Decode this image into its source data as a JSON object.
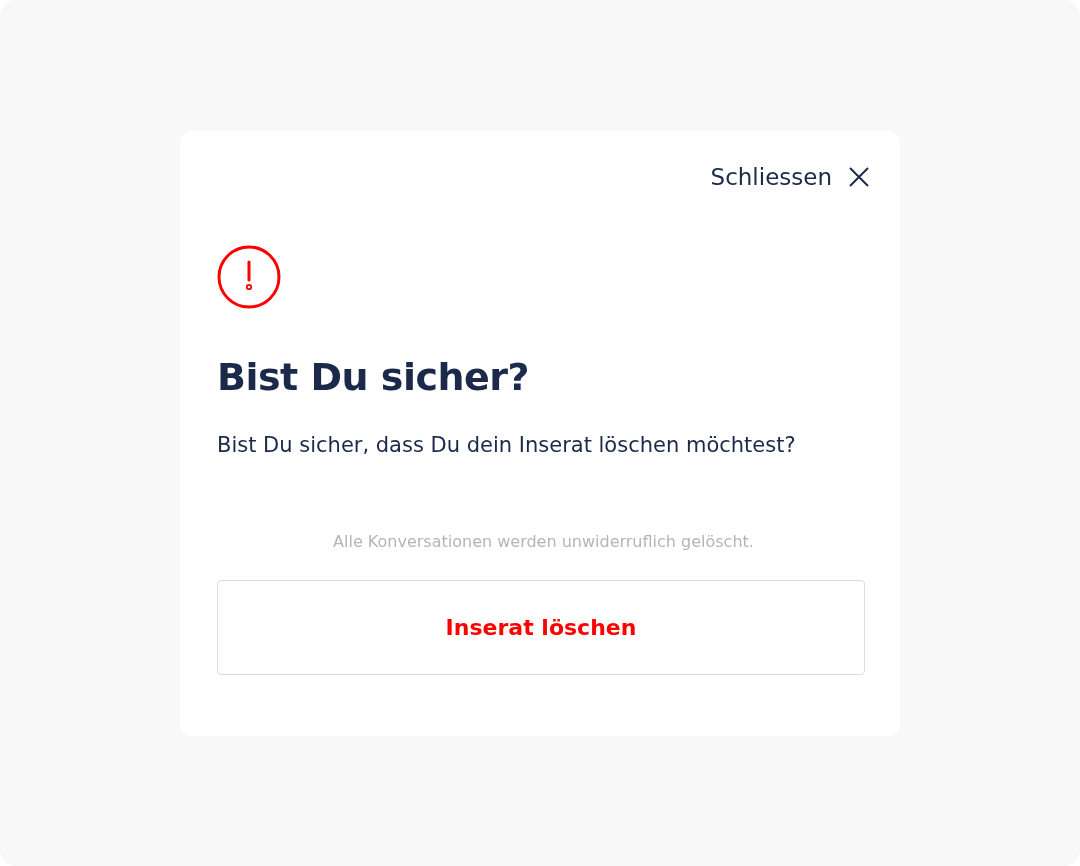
{
  "dialog": {
    "close_label": "Schliessen",
    "title": "Bist Du sicher?",
    "message": "Bist Du sicher, dass Du dein Inserat löschen möchtest?",
    "note": "Alle Konversationen werden unwiderruflich gelöscht.",
    "confirm_button": "Inserat löschen"
  }
}
